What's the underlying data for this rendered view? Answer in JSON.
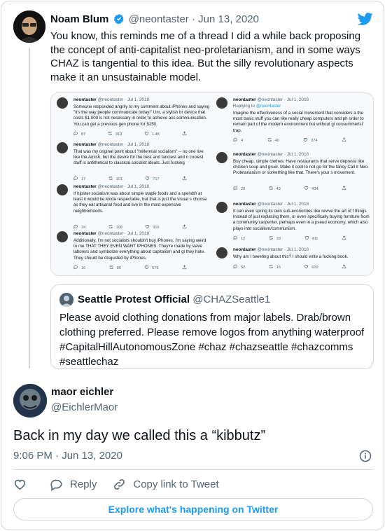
{
  "post": {
    "name": "Noam Blum",
    "handle": "@neontaster",
    "date": "Jun 13, 2020",
    "text": "You know, this reminds me of a thread I did a while back proposing the concept of anti-capitalist neo-proletarianism, and in some ways CHAZ is tangential to this idea. But the silly revolutionary aspects make it an unsustainable model."
  },
  "screenshot": {
    "left": [
      {
        "name": "neontaster",
        "meta": "@neontaster · Jul 1, 2018",
        "text": "Someone responded angrily to my comment about iPhones and saying \"it's the way people communicate today!\" Um, a stylish br device that costs $1,000 is not necessary in order to achieve acc communication. You can get a previous gen phone for $150.",
        "reply": "87",
        "retweet": "319",
        "like": "1.4K"
      },
      {
        "name": "neontaster",
        "meta": "@neontaster · Jul 1, 2018",
        "text": "That was my original point about \"millennial socialism\" -- no one live like the Amish, but the desire for the best and fanciest and n coolest stuff is antithetical to classical socialist ideals. Just fucking",
        "reply": "17",
        "retweet": "101",
        "like": "717"
      },
      {
        "name": "neontaster",
        "meta": "@neontaster · Jul 1, 2018",
        "text": "If hipster socialism was about simple staple foods and a spendth at least it would be kinda respectable, but that is just the visual s choose as they eat artisanal food and live in the most expensive neighborhoods.",
        "reply": "24",
        "retweet": "108",
        "like": "916"
      },
      {
        "name": "neontaster",
        "meta": "@neontaster · Jul 1, 2018",
        "text": "Additionally, I'm not socialists shouldn't buy iPhones. I'm saying weird to me THAT THEY EVEN WANT IPHONES. They're made by slave laborers and symbolize everything about capitalism and gl they hate. They should be disgusted by iPhones.",
        "reply": "16",
        "retweet": "96",
        "like": "676"
      }
    ],
    "right": [
      {
        "name": "neontaster",
        "meta": "@neontaster · Jul 1, 2018",
        "reply_prefix": "Replying to ",
        "reply_to": "@neontaster",
        "text": "Imagine the effectiveness of a social movement that considers a the most basic stuff you can like really cheap computers and ph order to remain part of the modern environment but without gi consummerist trap.",
        "reply": "4",
        "retweet": "40",
        "like": "374"
      },
      {
        "name": "neontaster",
        "meta": "@neontaster · Jul 1, 2018",
        "text": "Buy cheap, simple clothes. Have restaurants that serve depressi like chicken soup and gruel. Make it cool to not go for the fancy Call it Neo-Proletarianism or something like that. There's your s movement.",
        "reply": "20",
        "retweet": "43",
        "like": "434"
      },
      {
        "name": "neontaster",
        "meta": "@neontaster · Jul 1, 2018",
        "text": "It can even spring its own sub-economies like revive the art of f things instead of just replacing them, or even specifically buying furniture from a community carpenter, perhaps even in a pseud economy, which also plays into socialism/communism.",
        "reply": "12",
        "retweet": "33",
        "like": "411"
      },
      {
        "name": "neontaster",
        "meta": "@neontaster · Jul 1, 2018",
        "text": "Why am I tweeting about this? I should write a fucking book.",
        "reply": "52",
        "retweet": "16",
        "like": "620"
      }
    ]
  },
  "quote": {
    "name": "Seattle Protest Official",
    "handle": "@CHAZSeattle1",
    "text": "Please avoid clothing donations from major labels. Drab/brown clothing preferred. Please remove logos from anything waterproof #CapitalHillAutonomousZone #chaz #chazseattle #chazcomms #seattlechaz"
  },
  "reply": {
    "name": "maor eichler",
    "handle": "@EichlerMaor",
    "text": "Back in my day we called this a “kibbutz”",
    "timestamp": "9:06 PM · Jun 13, 2020"
  },
  "actions": {
    "reply_label": "Reply",
    "copy_label": "Copy link to Tweet"
  },
  "explore_label": "Explore what's happening on Twitter",
  "colors": {
    "accent": "#1d9bf0",
    "muted": "#536471",
    "border": "#cfd9de"
  },
  "icons": [
    "twitter-bird-icon",
    "verified-badge-icon",
    "heart-icon",
    "reply-icon",
    "link-icon",
    "info-icon"
  ]
}
